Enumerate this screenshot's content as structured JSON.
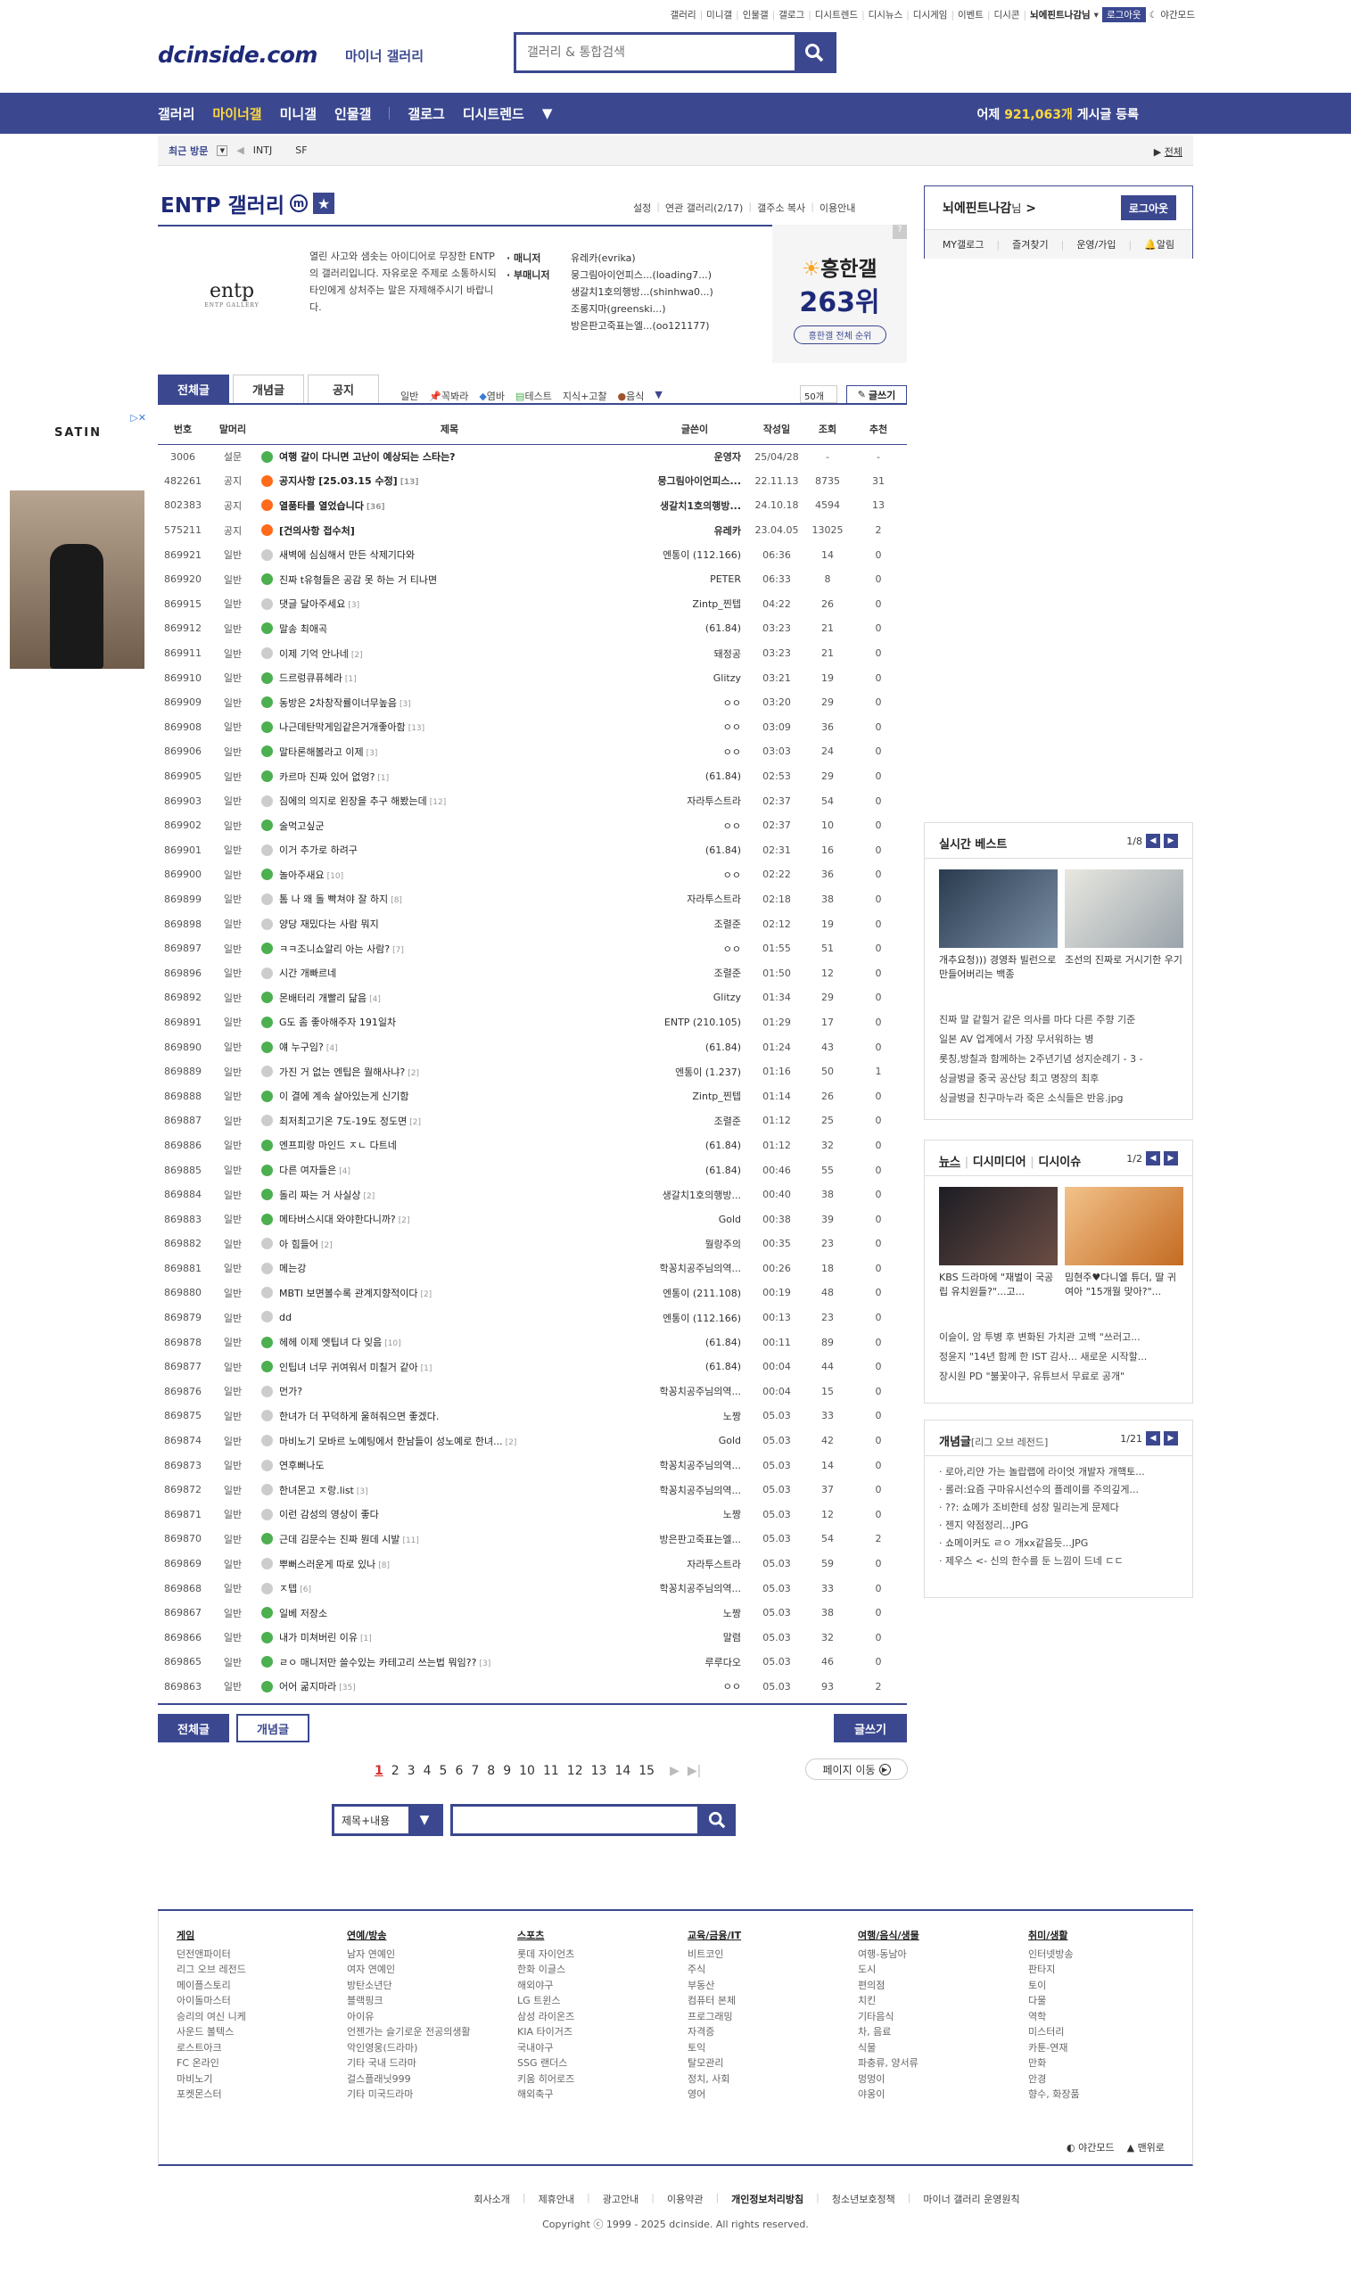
{
  "top_links": [
    "갤러리",
    "미니갤",
    "인물갤",
    "갤로그",
    "디시트렌드",
    "디시뉴스",
    "디시게임",
    "이벤트",
    "디시콘"
  ],
  "top_user": "뇌에핀트나감님",
  "top_logout": "로그아웃",
  "top_night": "야간모드",
  "logo": "dcinside.com",
  "logo_sub": "마이너 갤러리",
  "search_placeholder": "갤러리 & 통합검색",
  "gnb": {
    "items": [
      "갤러리",
      "마이너갤",
      "미니갤",
      "인물갤",
      "갤로그",
      "디시트렌드"
    ],
    "active_index": 1,
    "yesterday_prefix": "어제",
    "yesterday_count": "921,063개",
    "yesterday_suffix": "게시글 등록"
  },
  "recent": {
    "label": "최근 방문",
    "items": [
      "INTJ",
      "SF"
    ],
    "all": "전체"
  },
  "gallery": {
    "title": "ENTP 갤러리",
    "options": [
      "설정",
      "연관 갤러리(2/17)",
      "갤주소 복사",
      "이용안내"
    ],
    "logo_text": "entp",
    "logo_small": "ENTP GALLERY",
    "description": "열린 사고와 샘솟는 아이디어로 무장한 ENTP의 갤러리입니다. 자유로운 주제로 소통하시되 타인에게 상처주는 말은 자제해주시기 바랍니다.",
    "manager_label": "· 매니저",
    "sub_manager_label": "· 부매니저",
    "manager": "유레카(evrika)",
    "sub_managers": [
      "뭉그림아이언피스...(loading7...)",
      "생갈치1호의행방...(shinhwa0...)",
      "조롱지마(greenski...)",
      "방은판고죽표는엘...(oo121177)"
    ],
    "hot_title": "흥한갤",
    "hot_rank": "263위",
    "hot_button": "흥한갤 전체 순위",
    "hot_q": "?"
  },
  "tabs": [
    "전체글",
    "개념글",
    "공지"
  ],
  "heads": [
    "일반",
    "꼭봐라",
    "염바",
    "테스트",
    "지식+고찰",
    "음식"
  ],
  "list_num": "50개",
  "write_label": "글쓰기",
  "columns": [
    "번호",
    "말머리",
    "제목",
    "글쓴이",
    "작성일",
    "조회",
    "추천"
  ],
  "posts": [
    {
      "no": "3006",
      "head": "설문",
      "title": "여행 갈이 다니면 고난이 예상되는 스타는?",
      "cm": "",
      "writer": "운영자",
      "date": "25/04/28",
      "view": "-",
      "rec": "-",
      "notice": true,
      "ic": "g"
    },
    {
      "no": "482261",
      "head": "공지",
      "title": "공지사항 [25.03.15 수정]",
      "cm": "[13]",
      "writer": "뭉그림아이언피스...",
      "date": "22.11.13",
      "view": "8735",
      "rec": "31",
      "notice": true,
      "ic": "o"
    },
    {
      "no": "802383",
      "head": "공지",
      "title": "열품타를 열었습니다",
      "cm": "[36]",
      "writer": "생갈치1호의행방...",
      "date": "24.10.18",
      "view": "4594",
      "rec": "13",
      "notice": true,
      "ic": "o"
    },
    {
      "no": "575211",
      "head": "공지",
      "title": "[건의사항 접수처]",
      "cm": "",
      "writer": "유레카",
      "date": "23.04.05",
      "view": "13025",
      "rec": "2",
      "notice": true,
      "ic": "o"
    },
    {
      "no": "869921",
      "head": "일반",
      "title": "새벽에 심심해서 만든 삭제기다와",
      "cm": "",
      "writer": "엔통이 (112.166)",
      "date": "06:36",
      "view": "14",
      "rec": "0",
      "ic": "c"
    },
    {
      "no": "869920",
      "head": "일반",
      "title": "진짜 t유형들은 공감 못 하는 거 티나면",
      "cm": "",
      "writer": "PETER",
      "date": "06:33",
      "view": "8",
      "rec": "0",
      "ic": "g"
    },
    {
      "no": "869915",
      "head": "일반",
      "title": "댓글 달아주세요",
      "cm": "[3]",
      "writer": "Zintp_찐텝",
      "date": "04:22",
      "view": "26",
      "rec": "0",
      "ic": "c"
    },
    {
      "no": "869912",
      "head": "일반",
      "title": "말송 최애곡",
      "cm": "",
      "writer": "(61.84)",
      "date": "03:23",
      "view": "21",
      "rec": "0",
      "ic": "g"
    },
    {
      "no": "869911",
      "head": "일반",
      "title": "이제 기억 안나네",
      "cm": "[2]",
      "writer": "돼정공",
      "date": "03:23",
      "view": "21",
      "rec": "0",
      "ic": "c"
    },
    {
      "no": "869910",
      "head": "일반",
      "title": "드르렁큐퓨헤라",
      "cm": "[1]",
      "writer": "Glitzy",
      "date": "03:21",
      "view": "19",
      "rec": "0",
      "ic": "g"
    },
    {
      "no": "869909",
      "head": "일반",
      "title": "동방은 2차창작률이너무높음",
      "cm": "[3]",
      "writer": "ㅇㅇ",
      "date": "03:20",
      "view": "29",
      "rec": "0",
      "ic": "g"
    },
    {
      "no": "869908",
      "head": "일반",
      "title": "나근데탄막게임같은거개좋아함",
      "cm": "[13]",
      "writer": "ㅇㅇ",
      "date": "03:09",
      "view": "36",
      "rec": "0",
      "ic": "g"
    },
    {
      "no": "869906",
      "head": "일반",
      "title": "말타론해볼라고 이제",
      "cm": "[3]",
      "writer": "ㅇㅇ",
      "date": "03:03",
      "view": "24",
      "rec": "0",
      "ic": "g"
    },
    {
      "no": "869905",
      "head": "일반",
      "title": "카르마 진짜 있어 없엉?",
      "cm": "[1]",
      "writer": "(61.84)",
      "date": "02:53",
      "view": "29",
      "rec": "0",
      "ic": "g"
    },
    {
      "no": "869903",
      "head": "일반",
      "title": "짐에의 의지로 왼장을 추구 해봤는데",
      "cm": "[12]",
      "writer": "자라투스트라",
      "date": "02:37",
      "view": "54",
      "rec": "0",
      "ic": "c"
    },
    {
      "no": "869902",
      "head": "일반",
      "title": "술먹고싶군",
      "cm": "",
      "writer": "ㅇㅇ",
      "date": "02:37",
      "view": "10",
      "rec": "0",
      "ic": "g"
    },
    {
      "no": "869901",
      "head": "일반",
      "title": "이거 추가로 하려구",
      "cm": "",
      "writer": "(61.84)",
      "date": "02:31",
      "view": "16",
      "rec": "0",
      "ic": "c"
    },
    {
      "no": "869900",
      "head": "일반",
      "title": "놀아주새요",
      "cm": "[10]",
      "writer": "ㅇㅇ",
      "date": "02:22",
      "view": "36",
      "rec": "0",
      "ic": "g"
    },
    {
      "no": "869899",
      "head": "일반",
      "title": "톰 나 왜 돌 빡쳐야 잘 하지",
      "cm": "[8]",
      "writer": "자라투스트라",
      "date": "02:18",
      "view": "38",
      "rec": "0",
      "ic": "c"
    },
    {
      "no": "869898",
      "head": "일반",
      "title": "양당 재밌다는 사람 뭐지",
      "cm": "",
      "writer": "조렬준",
      "date": "02:12",
      "view": "19",
      "rec": "0",
      "ic": "c"
    },
    {
      "no": "869897",
      "head": "일반",
      "title": "ㅋㅋ조니쇼알리 아는 사람?",
      "cm": "[7]",
      "writer": "ㅇㅇ",
      "date": "01:55",
      "view": "51",
      "rec": "0",
      "ic": "g"
    },
    {
      "no": "869896",
      "head": "일반",
      "title": "시간 개빠르네",
      "cm": "",
      "writer": "조렬준",
      "date": "01:50",
      "view": "12",
      "rec": "0",
      "ic": "c"
    },
    {
      "no": "869892",
      "head": "일반",
      "title": "몬배터리 개빨리 닮음",
      "cm": "[4]",
      "writer": "Glitzy",
      "date": "01:34",
      "view": "29",
      "rec": "0",
      "ic": "g"
    },
    {
      "no": "869891",
      "head": "일반",
      "title": "G도 좀 좋아해주자 191일차",
      "cm": "",
      "writer": "ENTP (210.105)",
      "date": "01:29",
      "view": "17",
      "rec": "0",
      "ic": "g"
    },
    {
      "no": "869890",
      "head": "일반",
      "title": "얘 누구임?",
      "cm": "[4]",
      "writer": "(61.84)",
      "date": "01:24",
      "view": "43",
      "rec": "0",
      "ic": "g"
    },
    {
      "no": "869889",
      "head": "일반",
      "title": "가진 거 없는 엔팁은 뭘해사냐?",
      "cm": "[2]",
      "writer": "엔통이 (1.237)",
      "date": "01:16",
      "view": "50",
      "rec": "1",
      "ic": "c"
    },
    {
      "no": "869888",
      "head": "일반",
      "title": "이 결에 계속 살아있는게 신기함",
      "cm": "",
      "writer": "Zintp_찐텝",
      "date": "01:14",
      "view": "26",
      "rec": "0",
      "ic": "g"
    },
    {
      "no": "869887",
      "head": "일반",
      "title": "최저최고기온 7도-19도 정도면",
      "cm": "[2]",
      "writer": "조렬준",
      "date": "01:12",
      "view": "25",
      "rec": "0",
      "ic": "c"
    },
    {
      "no": "869886",
      "head": "일반",
      "title": "엔프피랑 마인드 ㅈㄴ 다트네",
      "cm": "",
      "writer": "(61.84)",
      "date": "01:12",
      "view": "32",
      "rec": "0",
      "ic": "g"
    },
    {
      "no": "869885",
      "head": "일반",
      "title": "다른 여자들은",
      "cm": "[4]",
      "writer": "(61.84)",
      "date": "00:46",
      "view": "55",
      "rec": "0",
      "ic": "g"
    },
    {
      "no": "869884",
      "head": "일반",
      "title": "돌리 짜는 거 사실상",
      "cm": "[2]",
      "writer": "생갈치1호의행방...",
      "date": "00:40",
      "view": "38",
      "rec": "0",
      "ic": "g"
    },
    {
      "no": "869883",
      "head": "일반",
      "title": "메타버스시대 와야한다니까?",
      "cm": "[2]",
      "writer": "Gold",
      "date": "00:38",
      "view": "39",
      "rec": "0",
      "ic": "g"
    },
    {
      "no": "869882",
      "head": "일반",
      "title": "아 힘들어",
      "cm": "[2]",
      "writer": "뭘랑주의",
      "date": "00:35",
      "view": "23",
      "rec": "0",
      "ic": "c"
    },
    {
      "no": "869881",
      "head": "일반",
      "title": "메는강",
      "cm": "",
      "writer": "학꽁치공주님의역...",
      "date": "00:26",
      "view": "18",
      "rec": "0",
      "ic": "c"
    },
    {
      "no": "869880",
      "head": "일반",
      "title": "MBTI 보면볼수록 관계지향적이다",
      "cm": "[2]",
      "writer": "엔통이 (211.108)",
      "date": "00:19",
      "view": "48",
      "rec": "0",
      "ic": "c"
    },
    {
      "no": "869879",
      "head": "일반",
      "title": "dd",
      "cm": "",
      "writer": "엔통이 (112.166)",
      "date": "00:13",
      "view": "23",
      "rec": "0",
      "ic": "c"
    },
    {
      "no": "869878",
      "head": "일반",
      "title": "헤헤 이제 엣팁녀 다 잊음",
      "cm": "[10]",
      "writer": "(61.84)",
      "date": "00:11",
      "view": "89",
      "rec": "0",
      "ic": "g"
    },
    {
      "no": "869877",
      "head": "일반",
      "title": "인팁녀 너무 귀여워서 미칠거 같아",
      "cm": "[1]",
      "writer": "(61.84)",
      "date": "00:04",
      "view": "44",
      "rec": "0",
      "ic": "g"
    },
    {
      "no": "869876",
      "head": "일반",
      "title": "먼가?",
      "cm": "",
      "writer": "학꽁치공주님의역...",
      "date": "00:04",
      "view": "15",
      "rec": "0",
      "ic": "c"
    },
    {
      "no": "869875",
      "head": "일반",
      "title": "한녀가 더 꾸덕하게 울혀줘으면 좋겠다.",
      "cm": "",
      "writer": "노짱",
      "date": "05.03",
      "view": "33",
      "rec": "0",
      "ic": "c"
    },
    {
      "no": "869874",
      "head": "일반",
      "title": "마비노기 모바르 노예팅에서 한남들이 성노예로 한녀...",
      "cm": "[2]",
      "writer": "Gold",
      "date": "05.03",
      "view": "42",
      "rec": "0",
      "ic": "c"
    },
    {
      "no": "869873",
      "head": "일반",
      "title": "연후뻐나도",
      "cm": "",
      "writer": "학꽁치공주님의역...",
      "date": "05.03",
      "view": "14",
      "rec": "0",
      "ic": "c"
    },
    {
      "no": "869872",
      "head": "일반",
      "title": "한녀몬고 ㅈ랑.list",
      "cm": "[3]",
      "writer": "학꽁치공주님의역...",
      "date": "05.03",
      "view": "37",
      "rec": "0",
      "ic": "c"
    },
    {
      "no": "869871",
      "head": "일반",
      "title": "이런 감성의 영상이 좋다",
      "cm": "",
      "writer": "노짱",
      "date": "05.03",
      "view": "12",
      "rec": "0",
      "ic": "c"
    },
    {
      "no": "869870",
      "head": "일반",
      "title": "근데 김문수는 진짜 뭔데 시발",
      "cm": "[11]",
      "writer": "방은판고죽표는엘...",
      "date": "05.03",
      "view": "54",
      "rec": "2",
      "ic": "g"
    },
    {
      "no": "869869",
      "head": "일반",
      "title": "뿌뻐스러운게 따로 있나",
      "cm": "[8]",
      "writer": "자라투스트라",
      "date": "05.03",
      "view": "59",
      "rec": "0",
      "ic": "c"
    },
    {
      "no": "869868",
      "head": "일반",
      "title": "ㅈ텝",
      "cm": "[6]",
      "writer": "학꽁치공주님의역...",
      "date": "05.03",
      "view": "33",
      "rec": "0",
      "ic": "c"
    },
    {
      "no": "869867",
      "head": "일반",
      "title": "일베 저장소",
      "cm": "",
      "writer": "노짱",
      "date": "05.03",
      "view": "38",
      "rec": "0",
      "ic": "g"
    },
    {
      "no": "869866",
      "head": "일반",
      "title": "내가 미쳐버린 이유",
      "cm": "[1]",
      "writer": "말렴",
      "date": "05.03",
      "view": "32",
      "rec": "0",
      "ic": "g"
    },
    {
      "no": "869865",
      "head": "일반",
      "title": "ㄹㅇ 매니저만 쓸수있는 카테고리 쓰는법 뭐임??",
      "cm": "[3]",
      "writer": "루루다오",
      "date": "05.03",
      "view": "46",
      "rec": "0",
      "ic": "g"
    },
    {
      "no": "869863",
      "head": "일반",
      "title": "어어 굶지마라",
      "cm": "[35]",
      "writer": "ㅇㅇ",
      "date": "05.03",
      "view": "93",
      "rec": "2",
      "ic": "g"
    }
  ],
  "bottom_buttons": {
    "all": "전체글",
    "best": "개념글",
    "write": "글쓰기"
  },
  "paging": {
    "pages": [
      "1",
      "2",
      "3",
      "4",
      "5",
      "6",
      "7",
      "8",
      "9",
      "10",
      "11",
      "12",
      "13",
      "14",
      "15"
    ],
    "current": "1",
    "move": "페이지 이동"
  },
  "bottom_search": {
    "select": "제목+내용"
  },
  "login": {
    "name": "뇌에핀트나감",
    "suffix": "님",
    "logout": "로그아웃",
    "menu": [
      "MY갤로그",
      "즐겨찾기",
      "운영/가입",
      "알림"
    ]
  },
  "ad": {
    "brand": "SATIN"
  },
  "realtime": {
    "title": "실시간 베스트",
    "page": "1/8",
    "thumbs": [
      {
        "cap": "개추요청))) 경영좌 빌런으로 만들어버리는 백종"
      },
      {
        "cap": "조선의 진짜로 거시기한 우기"
      }
    ],
    "list": [
      "진짜 말 같힐거 같은 의사를 마다 다른 주향 기준",
      "일본 AV 업계에서 가장 무서워하는 병",
      "롯칭,방칠과 함께하는 2주년기념 성지순례기 - 3 -",
      "싱글벙글 중국 공산당 최고 명장의 최후",
      "싱글벙글 친구마누라 죽은 소식들은 반응.jpg"
    ]
  },
  "news": {
    "tabs": [
      "뉴스",
      "디시미디어",
      "디시이슈"
    ],
    "page": "1/2",
    "thumbs": [
      {
        "cap": "KBS 드라마에 \"재벌이 국공립 유치원들?\"...고..."
      },
      {
        "cap": "밈현주♥다니엘 튜더, 딸 귀여아 \"15개월 맞아?\"..."
      }
    ],
    "list": [
      "이슬이, 암 투병 후 변화된 가치관 고백 \"쓰러고...",
      "정윤지 \"14년 함께 한 IST 감사... 새로운 시작할...",
      "장시원 PD \"불꽃야구, 유튜브서 무료로 공개\""
    ]
  },
  "concept": {
    "title": "개념글",
    "sub": "[리그 오브 레전드]",
    "page": "1/21",
    "list": [
      "로아,리얀 가는 놀랍랩에 라이엇 개발자 개핵토...",
      "롤러:요즘 구마유시선수의 플레이를 주의깊게...",
      "??: 쇼메가 조비한테 성장 밀리는게 문제다",
      "젠지 약점정리...JPG",
      "쇼메이커도 ㄹㅇ 개xx같음듯...JPG",
      "제우스 <- 신의 한수를 둔 느낌이 드네 ㄷㄷ"
    ]
  },
  "footer": {
    "cols": [
      {
        "h": "게임",
        "items": [
          "던전앤파이터",
          "리그 오브 레전드",
          "메이플스토리",
          "아이돌마스터",
          "승리의 여신 니케",
          "사운드 볼텍스",
          "로스트아크",
          "FC 온라인",
          "마비노기",
          "포켓몬스터"
        ]
      },
      {
        "h": "연예/방송",
        "items": [
          "남자 연예인",
          "여자 연예인",
          "방탄소년단",
          "블랙핑크",
          "아이유",
          "언젠가는 슬기로운 전공의생활",
          "악인영웅(드라마)",
          "기타 국내 드라마",
          "걸스플래닛999",
          "기타 미국드라마"
        ]
      },
      {
        "h": "스포츠",
        "items": [
          "롯데 자이언츠",
          "한화 이글스",
          "해외야구",
          "LG 트윈스",
          "삼성 라이온즈",
          "KIA 타이거즈",
          "국내야구",
          "SSG 랜더스",
          "키움 히어로즈",
          "해외축구"
        ]
      },
      {
        "h": "교육/금융/IT",
        "items": [
          "비트코인",
          "주식",
          "부동산",
          "컴퓨터 본체",
          "프로그래밍",
          "자격증",
          "토익",
          "탈모관리",
          "정치, 사회",
          "영어"
        ]
      },
      {
        "h": "여행/음식/생물",
        "items": [
          "여행-동남아",
          "도시",
          "편의점",
          "치킨",
          "기타음식",
          "차, 음료",
          "식물",
          "파충류, 양서류",
          "멍멍이",
          "야옹이"
        ]
      },
      {
        "h": "취미/생활",
        "items": [
          "인터넷방송",
          "판타지",
          "토이",
          "다물",
          "역학",
          "미스터리",
          "카툰-연재",
          "만화",
          "안경",
          "향수, 화장품"
        ]
      }
    ],
    "tools": [
      "야간모드",
      "맨위로"
    ],
    "links": [
      "회사소개",
      "제휴안내",
      "광고안내",
      "이용약관",
      "개인정보처리방침",
      "청소년보호정책",
      "마이너 갤러리 운영원칙"
    ],
    "copyright": "Copyright ⓒ 1999 - 2025 dcinside. All rights reserved."
  }
}
